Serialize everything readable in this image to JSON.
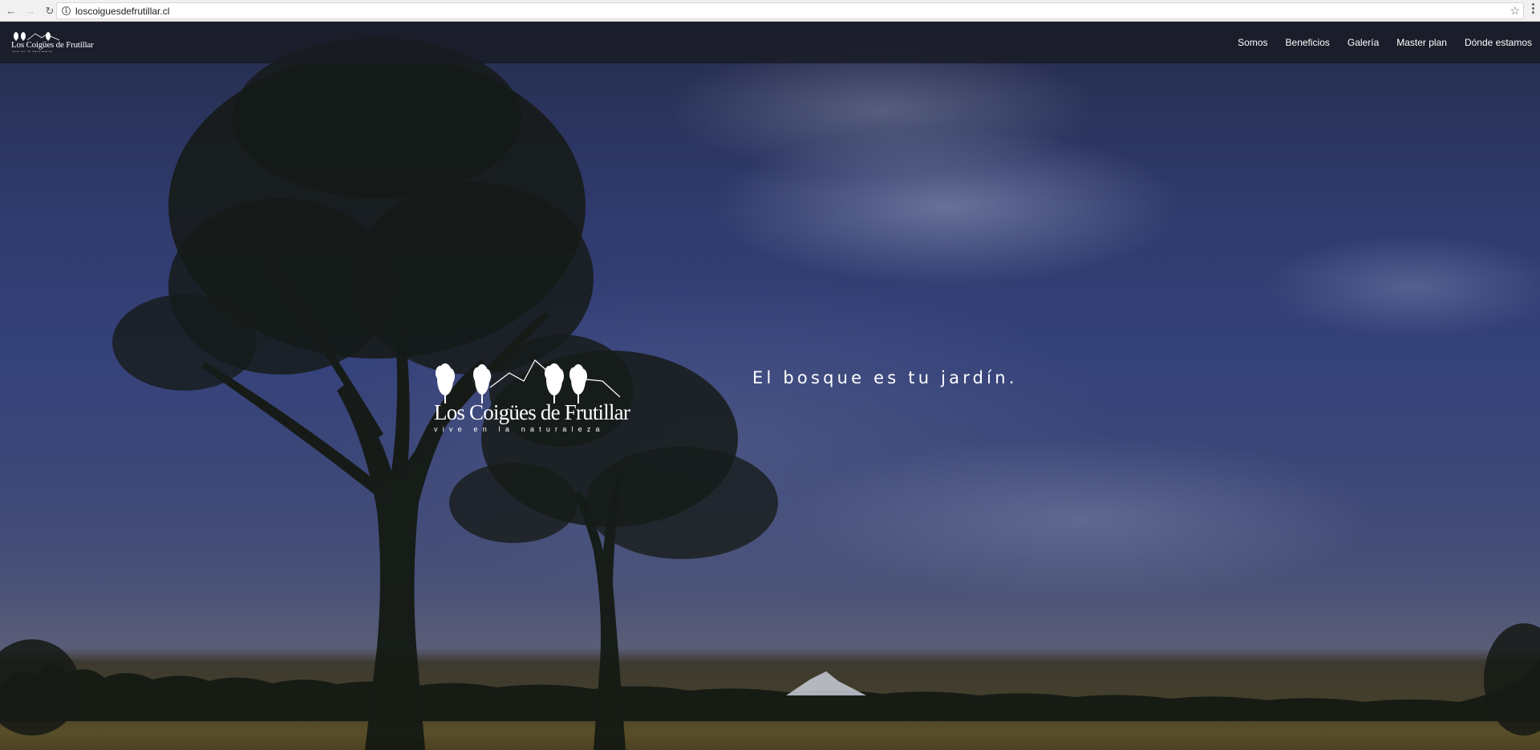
{
  "browser": {
    "back_icon": "←",
    "forward_icon": "→",
    "reload_icon": "↻",
    "info_icon": "i",
    "url": "loscoiguesdefrutillar.cl",
    "star_icon": "☆"
  },
  "header": {
    "logo_text": "Los Coigües de Frutillar",
    "logo_tagline": "vive en la naturaleza",
    "nav": {
      "somos": "Somos",
      "beneficios": "Beneficios",
      "galeria": "Galería",
      "master_plan": "Master plan",
      "donde_estamos": "Dónde estamos"
    }
  },
  "hero": {
    "logo_name": "Los Coigües de Frutillar",
    "logo_tagline": "vive en la naturaleza",
    "tagline": "El bosque es tu jardín."
  }
}
